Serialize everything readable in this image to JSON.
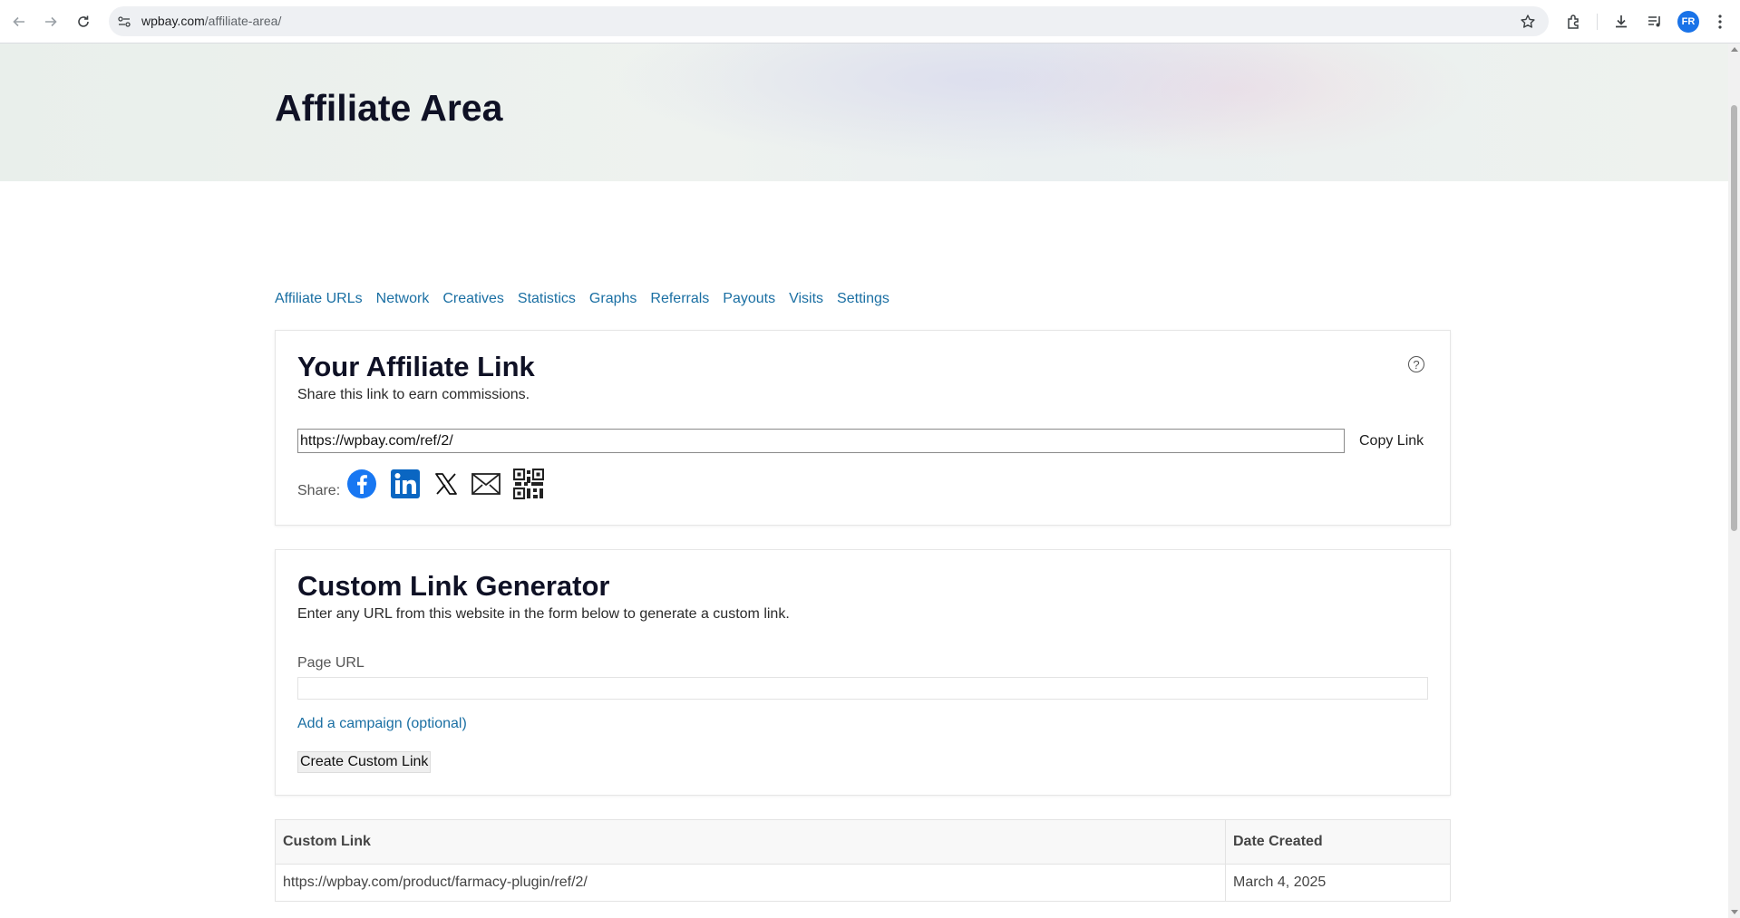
{
  "browser": {
    "url_domain": "wpbay.com",
    "url_path": "/affiliate-area/",
    "profile_initials": "FR"
  },
  "page": {
    "title": "Affiliate Area"
  },
  "tabs": [
    {
      "label": "Affiliate URLs"
    },
    {
      "label": "Network"
    },
    {
      "label": "Creatives"
    },
    {
      "label": "Statistics"
    },
    {
      "label": "Graphs"
    },
    {
      "label": "Referrals"
    },
    {
      "label": "Payouts"
    },
    {
      "label": "Visits"
    },
    {
      "label": "Settings"
    }
  ],
  "affiliate_link": {
    "title": "Your Affiliate Link",
    "subtitle": "Share this link to earn commissions.",
    "url": "https://wpbay.com/ref/2/",
    "copy_label": "Copy Link",
    "share_label": "Share:",
    "help_glyph": "?",
    "share_icons": [
      "facebook-icon",
      "linkedin-icon",
      "x-icon",
      "email-icon",
      "qr-code-icon"
    ]
  },
  "generator": {
    "title": "Custom Link Generator",
    "subtitle": "Enter any URL from this website in the form below to generate a custom link.",
    "field_label": "Page URL",
    "campaign_label": "Add a campaign (optional)",
    "button_label": "Create Custom Link"
  },
  "links_table": {
    "headers": [
      "Custom Link",
      "Date Created"
    ],
    "rows": [
      [
        "https://wpbay.com/product/farmacy-plugin/ref/2/",
        "March 4, 2025"
      ]
    ]
  },
  "colors": {
    "link_blue": "#1a6fa3",
    "heading": "#0f1125",
    "facebook": "#1877f2",
    "linkedin": "#0a66c2"
  }
}
